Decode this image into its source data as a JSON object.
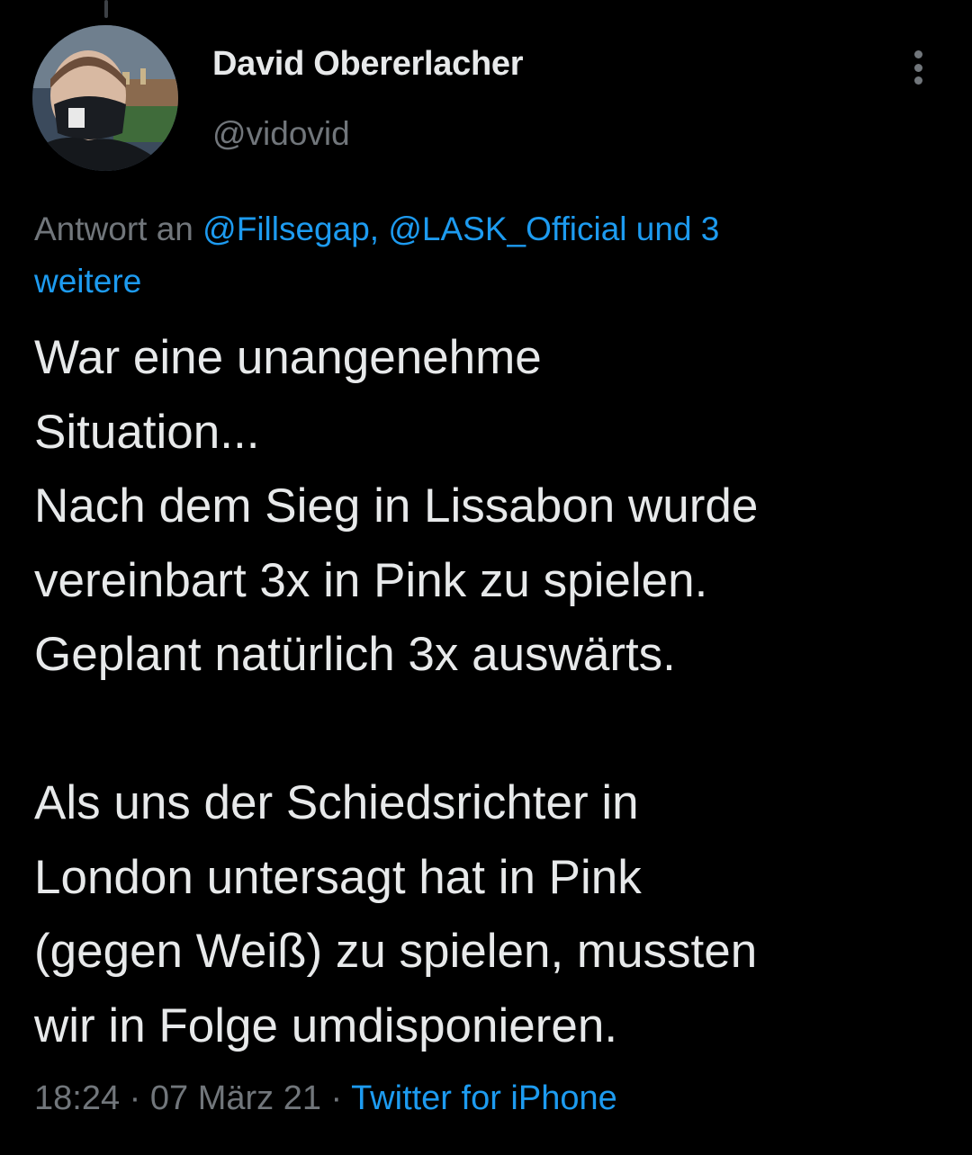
{
  "tweet": {
    "author": {
      "display_name": "David Obererlacher",
      "handle": "@vidovid"
    },
    "reply_to": {
      "prefix": "Antwort an",
      "mentions": "@Fillsegap, @LASK_Official und 3",
      "more": "weitere"
    },
    "text_lines": [
      "War eine unangenehme",
      "Situation...",
      "Nach dem Sieg in Lissabon wurde",
      "vereinbart 3x in Pink zu spielen.",
      "Geplant natürlich 3x auswärts.",
      "",
      "Als uns der Schiedsrichter in",
      "London untersagt hat in Pink",
      "(gegen Weiß) zu spielen, mussten",
      "wir in Folge umdisponieren."
    ],
    "meta": {
      "time": "18:24",
      "separator": "·",
      "date": "07 März 21",
      "source": "Twitter for iPhone"
    },
    "icons": {
      "more": "more-vertical-icon",
      "avatar": "profile-photo"
    },
    "colors": {
      "background": "#000000",
      "text": "#e7e9ea",
      "secondary": "#71767b",
      "link": "#1d9bf0"
    }
  }
}
